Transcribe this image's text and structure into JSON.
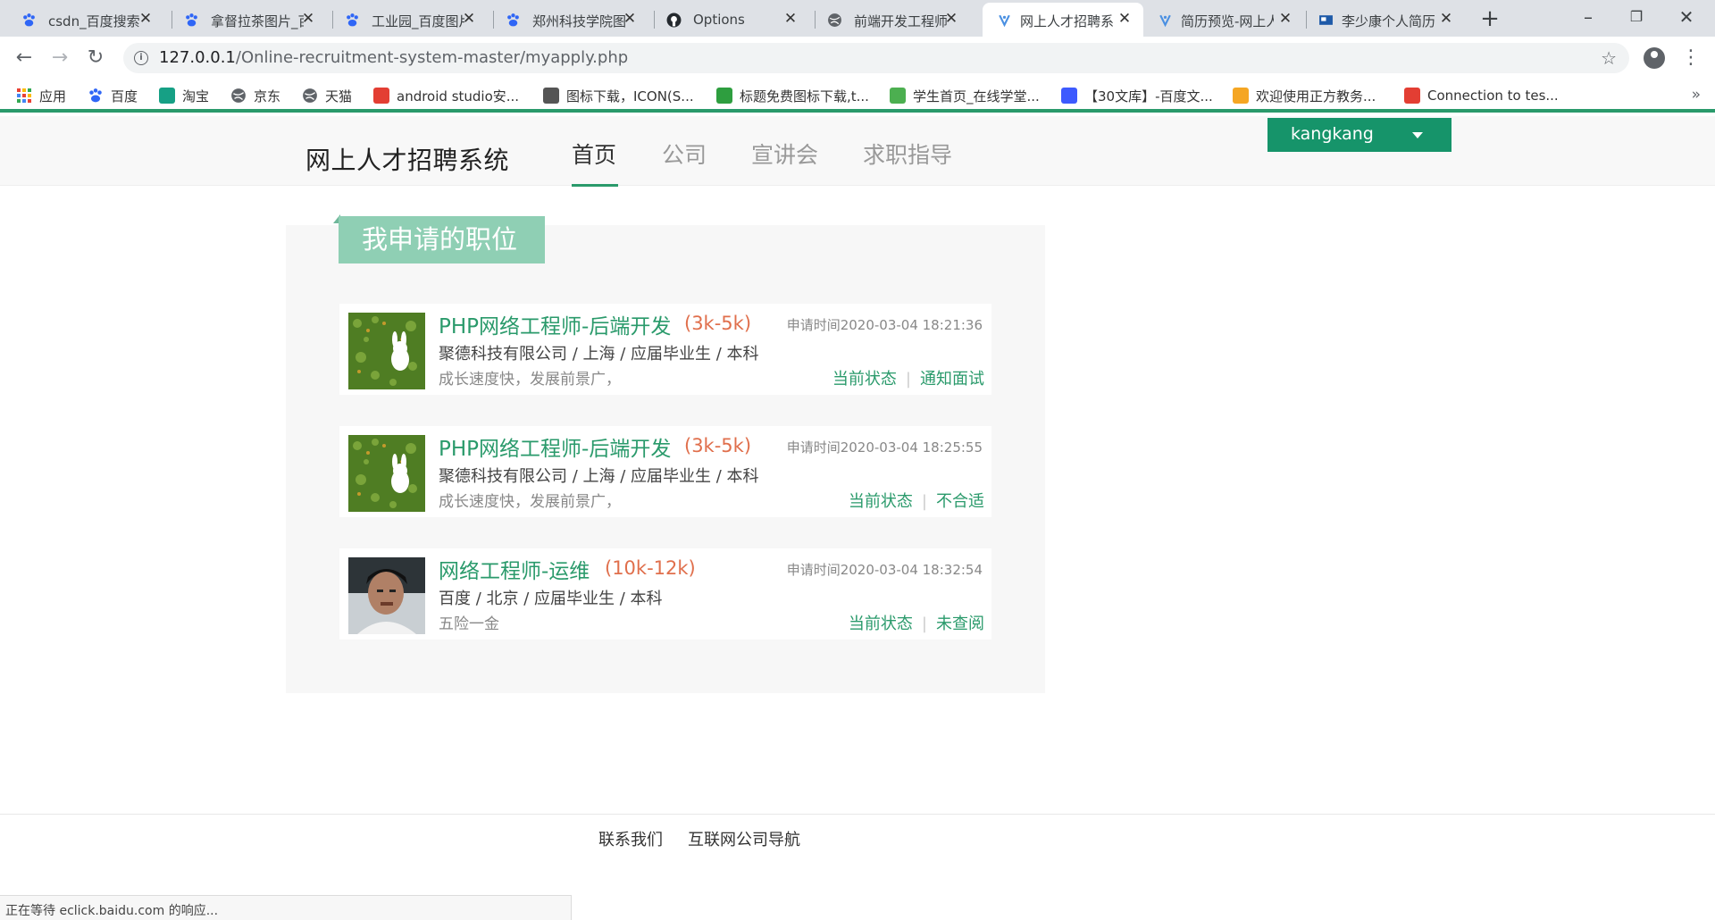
{
  "browser": {
    "tabs": [
      {
        "title": "csdn_百度搜索",
        "icon": "baidu-paw-icon",
        "color": "#2f66f6"
      },
      {
        "title": "拿督拉茶图片_百度图片",
        "icon": "baidu-paw-icon",
        "color": "#2f66f6"
      },
      {
        "title": "工业园_百度图片",
        "icon": "baidu-paw-icon",
        "color": "#2f66f6"
      },
      {
        "title": "郑州科技学院图片",
        "icon": "baidu-paw-icon",
        "color": "#2f66f6"
      },
      {
        "title": "Options",
        "icon": "github-icon",
        "color": "#24292e"
      },
      {
        "title": "前端开发工程师",
        "icon": "globe-icon",
        "color": "#5f6368"
      },
      {
        "title": "网上人才招聘系统",
        "icon": "site-favicon",
        "color": "#4a90e2"
      },
      {
        "title": "简历预览-网上人才",
        "icon": "site-favicon",
        "color": "#4a90e2"
      },
      {
        "title": "李少康个人简历",
        "icon": "page-favicon",
        "color": "#1e5aa8"
      }
    ],
    "address": {
      "host": "127.0.0.1",
      "path": "/Online-recruitment-system-master/myapply.php"
    },
    "bookmarks": [
      {
        "label": "应用",
        "icon": "apps-grid-icon",
        "color": "#e94235"
      },
      {
        "label": "百度",
        "icon": "baidu-paw-icon",
        "color": "#2f66f6"
      },
      {
        "label": "淘宝",
        "icon": "taobao-icon",
        "color": "#16a085"
      },
      {
        "label": "京东",
        "icon": "globe-icon",
        "color": "#5f6368"
      },
      {
        "label": "天猫",
        "icon": "globe-icon",
        "color": "#5f6368"
      },
      {
        "label": "android studio安...",
        "icon": "csdn-icon",
        "color": "#e33e33"
      },
      {
        "label": "图标下载，ICON(S...",
        "icon": "iconfont-icon",
        "color": "#555555"
      },
      {
        "label": "标题免费图标下载,t...",
        "icon": "plus-green-icon",
        "color": "#2e9e3f"
      },
      {
        "label": "学生首页_在线学堂...",
        "icon": "wave-icon",
        "color": "#4caf50"
      },
      {
        "label": "【30文库】-百度文...",
        "icon": "s-icon",
        "color": "#3d5afe"
      },
      {
        "label": "欢迎使用正方教务...",
        "icon": "cube-icon",
        "color": "#f5a623"
      },
      {
        "label": "Connection to tes...",
        "icon": "csdn-icon",
        "color": "#e33e33"
      }
    ],
    "status_text": "正在等待 eclick.baidu.com 的响应..."
  },
  "site": {
    "logo": "网上人才招聘系统",
    "nav": [
      "首页",
      "公司",
      "宣讲会",
      "求职指导"
    ],
    "user": "kangkang",
    "accent": "#2a9a6b"
  },
  "main": {
    "title": "我申请的职位",
    "jobs": [
      {
        "title": "PHP网络工程师-后端开发",
        "salary": "(3k-5k)",
        "time": "申请时间2020-03-04 18:21:36",
        "meta": "聚德科技有限公司 / 上海 / 应届毕业生 / 本科",
        "desc": "成长速度快，发展前景广，",
        "status_label": "当前状态",
        "status_value": "通知面试",
        "thumb": "green-rabbit-image"
      },
      {
        "title": "PHP网络工程师-后端开发",
        "salary": "(3k-5k)",
        "time": "申请时间2020-03-04 18:25:55",
        "meta": "聚德科技有限公司 / 上海 / 应届毕业生 / 本科",
        "desc": "成长速度快，发展前景广，",
        "status_label": "当前状态",
        "status_value": "不合适",
        "thumb": "green-rabbit-image"
      },
      {
        "title": "网络工程师-运维",
        "salary": "(10k-12k)",
        "time": "申请时间2020-03-04 18:32:54",
        "meta": "百度 / 北京 / 应届毕业生 / 本科",
        "desc": "五险一金",
        "status_label": "当前状态",
        "status_value": "未查阅",
        "thumb": "person-photo-image"
      }
    ]
  },
  "footer": {
    "links": [
      "联系我们",
      "互联网公司导航"
    ]
  }
}
